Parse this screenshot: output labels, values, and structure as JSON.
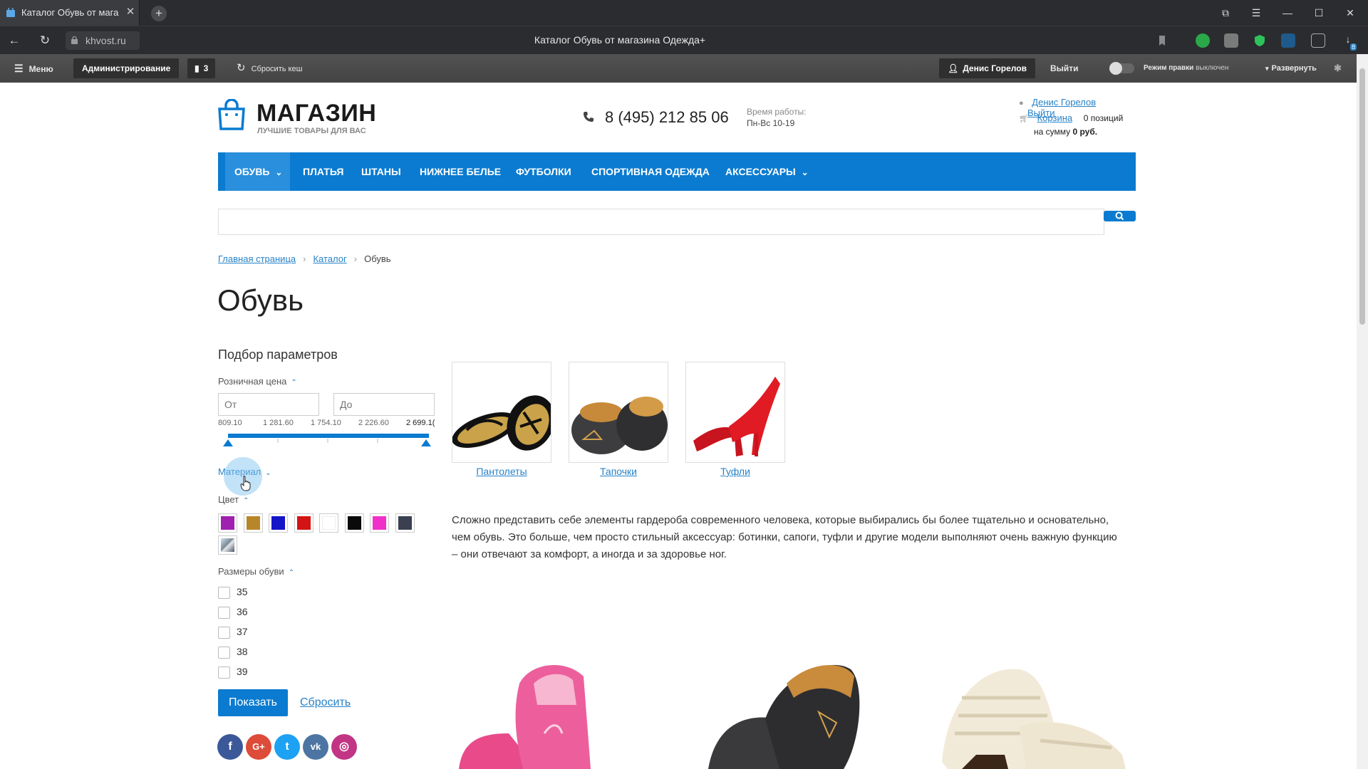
{
  "browser": {
    "tab_title": "Каталог Обувь от мага",
    "tab_close": "✕",
    "new_tab": "+",
    "url": "khvost.ru",
    "page_title": "Каталог Обувь от магазина Одежда+",
    "win_controls": [
      "⧉",
      "☰",
      "—",
      "☐",
      "✕"
    ],
    "download_badge": "8"
  },
  "admin": {
    "menu_label": "Меню",
    "administration": "Администрирование",
    "count_badge": "3",
    "reset_cache": "Сбросить кеш",
    "user": "Денис Горелов",
    "logout": "Выйти",
    "edit_mode_label": "Режим правки",
    "edit_mode_state": "выключен",
    "expand": "Развернуть"
  },
  "header": {
    "logo_title": "МАГАЗИН",
    "logo_subtitle": "ЛУЧШИЕ ТОВАРЫ ДЛЯ ВАС",
    "phone": "8 (495) 212 85 06",
    "hours_label": "Время работы:",
    "hours_value": "Пн-Вс 10-19",
    "user_name": "Денис Горелов",
    "logout": "Выйти",
    "cart_link": "Корзина",
    "cart_count": "0 позиций",
    "cart_sum_prefix": "на сумму",
    "cart_sum": "0 руб."
  },
  "menu": [
    {
      "label": "ОБУВЬ",
      "has_dropdown": true,
      "active": true
    },
    {
      "label": "ПЛАТЬЯ"
    },
    {
      "label": "ШТАНЫ"
    },
    {
      "label": "НИЖНЕЕ БЕЛЬЕ"
    },
    {
      "label": "ФУТБОЛКИ"
    },
    {
      "label": "СПОРТИВНАЯ ОДЕЖДА"
    },
    {
      "label": "АКСЕССУАРЫ",
      "has_dropdown": true
    }
  ],
  "menu_chevron": "⌄",
  "search": {
    "placeholder": "",
    "icon": "search-icon"
  },
  "breadcrumb": [
    "Главная страница",
    "Каталог",
    "Обувь"
  ],
  "breadcrumb_sep": "›",
  "page_heading": "Обувь",
  "filter": {
    "title": "Подбор параметров",
    "price_label": "Розничная цена",
    "price_from_placeholder": "От",
    "price_to_placeholder": "До",
    "price_ticks": [
      "809.10",
      "1 281.60",
      "1 754.10",
      "2 226.60",
      "2 699.1("
    ],
    "price_range_selected": [
      0,
      1
    ],
    "material_label": "Материал",
    "color_label": "Цвет",
    "colors": [
      "#a020b0",
      "#b8862a",
      "#1414c8",
      "#d41414",
      "#ffffff",
      "#0a0a0a",
      "#f030c8",
      "#3a4050"
    ],
    "sizes_label": "Размеры обуви",
    "sizes": [
      "35",
      "36",
      "37",
      "38",
      "39"
    ],
    "show_button": "Показать",
    "reset_link": "Сбросить",
    "chevron_up": "⌃",
    "chevron_down": "⌄"
  },
  "subcategories": [
    {
      "name": "Пантолеты"
    },
    {
      "name": "Тапочки"
    },
    {
      "name": "Туфли"
    }
  ],
  "description": "Сложно представить себе элементы гардероба современного человека, которые выбирались бы более тщательно и основательно, чем обувь. Это больше, чем просто стильный аксессуар: ботинки, сапоги, туфли и другие модели выполняют очень важную функцию – они отвечают за комфорт, а иногда и за здоровье ног.",
  "social": [
    {
      "name": "facebook",
      "glyph": "f",
      "color": "#3b5998"
    },
    {
      "name": "google-plus",
      "glyph": "G+",
      "color": "#dd4b39"
    },
    {
      "name": "twitter",
      "glyph": "t",
      "color": "#1da1f2"
    },
    {
      "name": "vk",
      "glyph": "vk",
      "color": "#4c75a3"
    },
    {
      "name": "instagram",
      "glyph": "◎",
      "color": "#c13584"
    }
  ],
  "colors": {
    "accent": "#0a7bd0",
    "link": "#2783c8",
    "admin_bg": "#4c4c4c"
  }
}
